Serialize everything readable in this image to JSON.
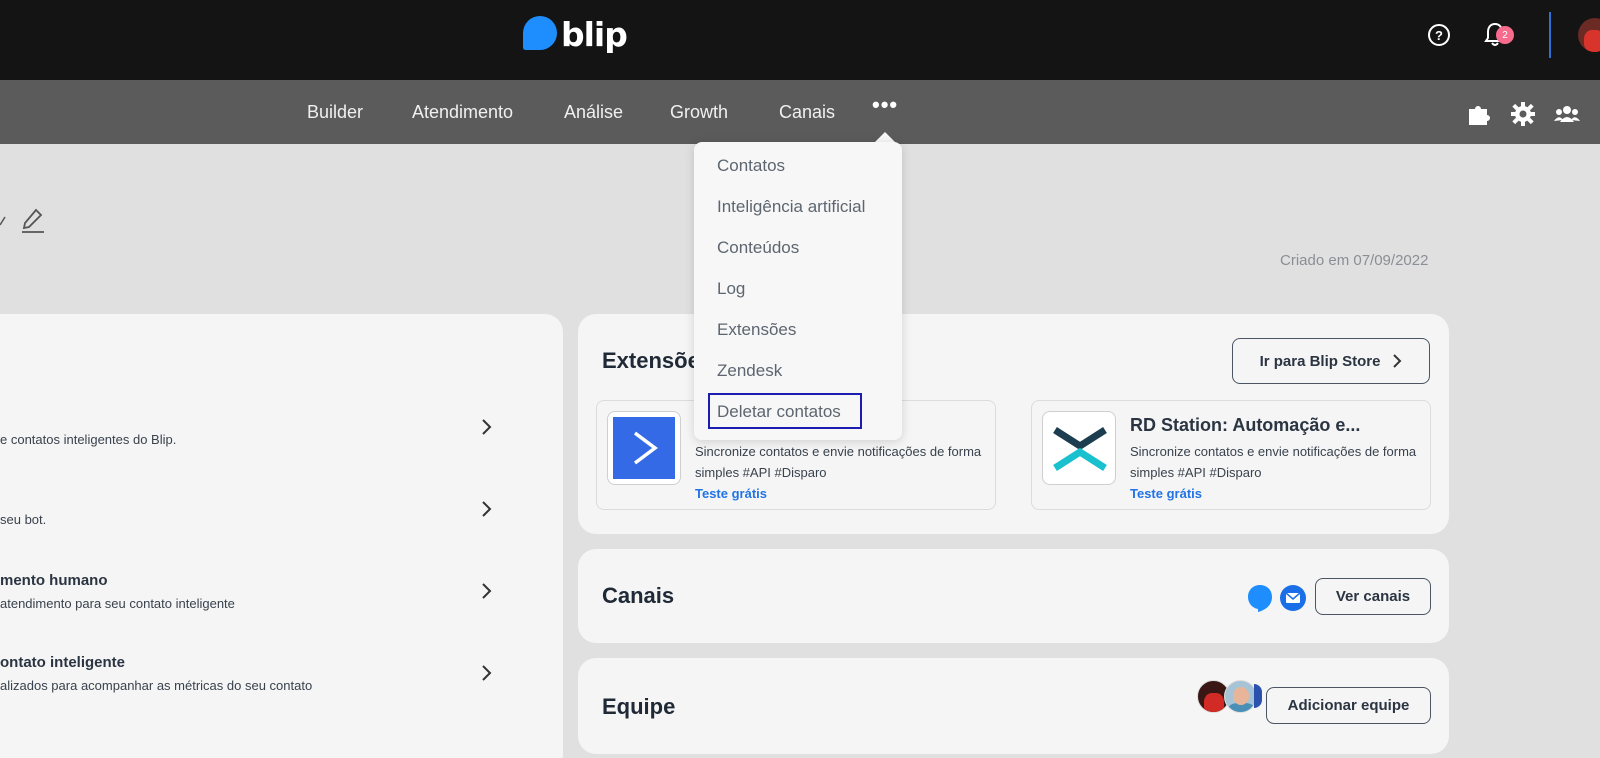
{
  "brand": {
    "name": "blip",
    "color": "#1e8eff"
  },
  "topbar": {
    "help_icon": "help-circle-icon",
    "help_glyph": "?",
    "notifications_icon": "bell-icon",
    "notifications_count": "2",
    "avatar": "user-avatar"
  },
  "nav": {
    "items": [
      "Builder",
      "Atendimento",
      "Análise",
      "Growth",
      "Canais"
    ],
    "more_label": "•••",
    "right_icons": [
      "puzzle-icon",
      "gear-icon",
      "users-icon"
    ]
  },
  "dropdown": {
    "items": [
      "Contatos",
      "Inteligência artificial",
      "Conteúdos",
      "Log",
      "Extensões",
      "Zendesk",
      "Deletar contatos"
    ],
    "highlighted": "Deletar contatos",
    "highlight_color": "#1c1cb0"
  },
  "header": {
    "edit_icon": "pencil-icon",
    "created_label": "Criado em  07/09/2022"
  },
  "left_card": {
    "rows": [
      {
        "title": "",
        "desc": "e contatos inteligentes do Blip."
      },
      {
        "title": "",
        "desc": "seu bot."
      },
      {
        "title": "mento humano",
        "desc": " atendimento para seu contato inteligente"
      },
      {
        "title": "ontato inteligente",
        "desc": "alizados para acompanhar as métricas do seu contato"
      }
    ]
  },
  "extensions": {
    "title": "Extensões",
    "store_button": "Ir para Blip Store",
    "items": [
      {
        "name": "",
        "desc": "Sincronize contatos e envie notificações de forma simples #API #Disparo",
        "cta": "Teste grátis",
        "logo_color": "#356ae6"
      },
      {
        "name": "RD Station: Automação e...",
        "desc": "Sincronize contatos e envie notificações de forma simples #API #Disparo",
        "cta": "Teste grátis",
        "logo_color": "#1c3d4f"
      }
    ]
  },
  "channels": {
    "title": "Canais",
    "button": "Ver canais",
    "icons": [
      "blip-chat-icon",
      "email-icon"
    ]
  },
  "team": {
    "title": "Equipe",
    "button": "Adicionar equipe"
  },
  "colors": {
    "link": "#2173e6",
    "accent": "#1e8eff",
    "badge": "#f76c8c"
  }
}
